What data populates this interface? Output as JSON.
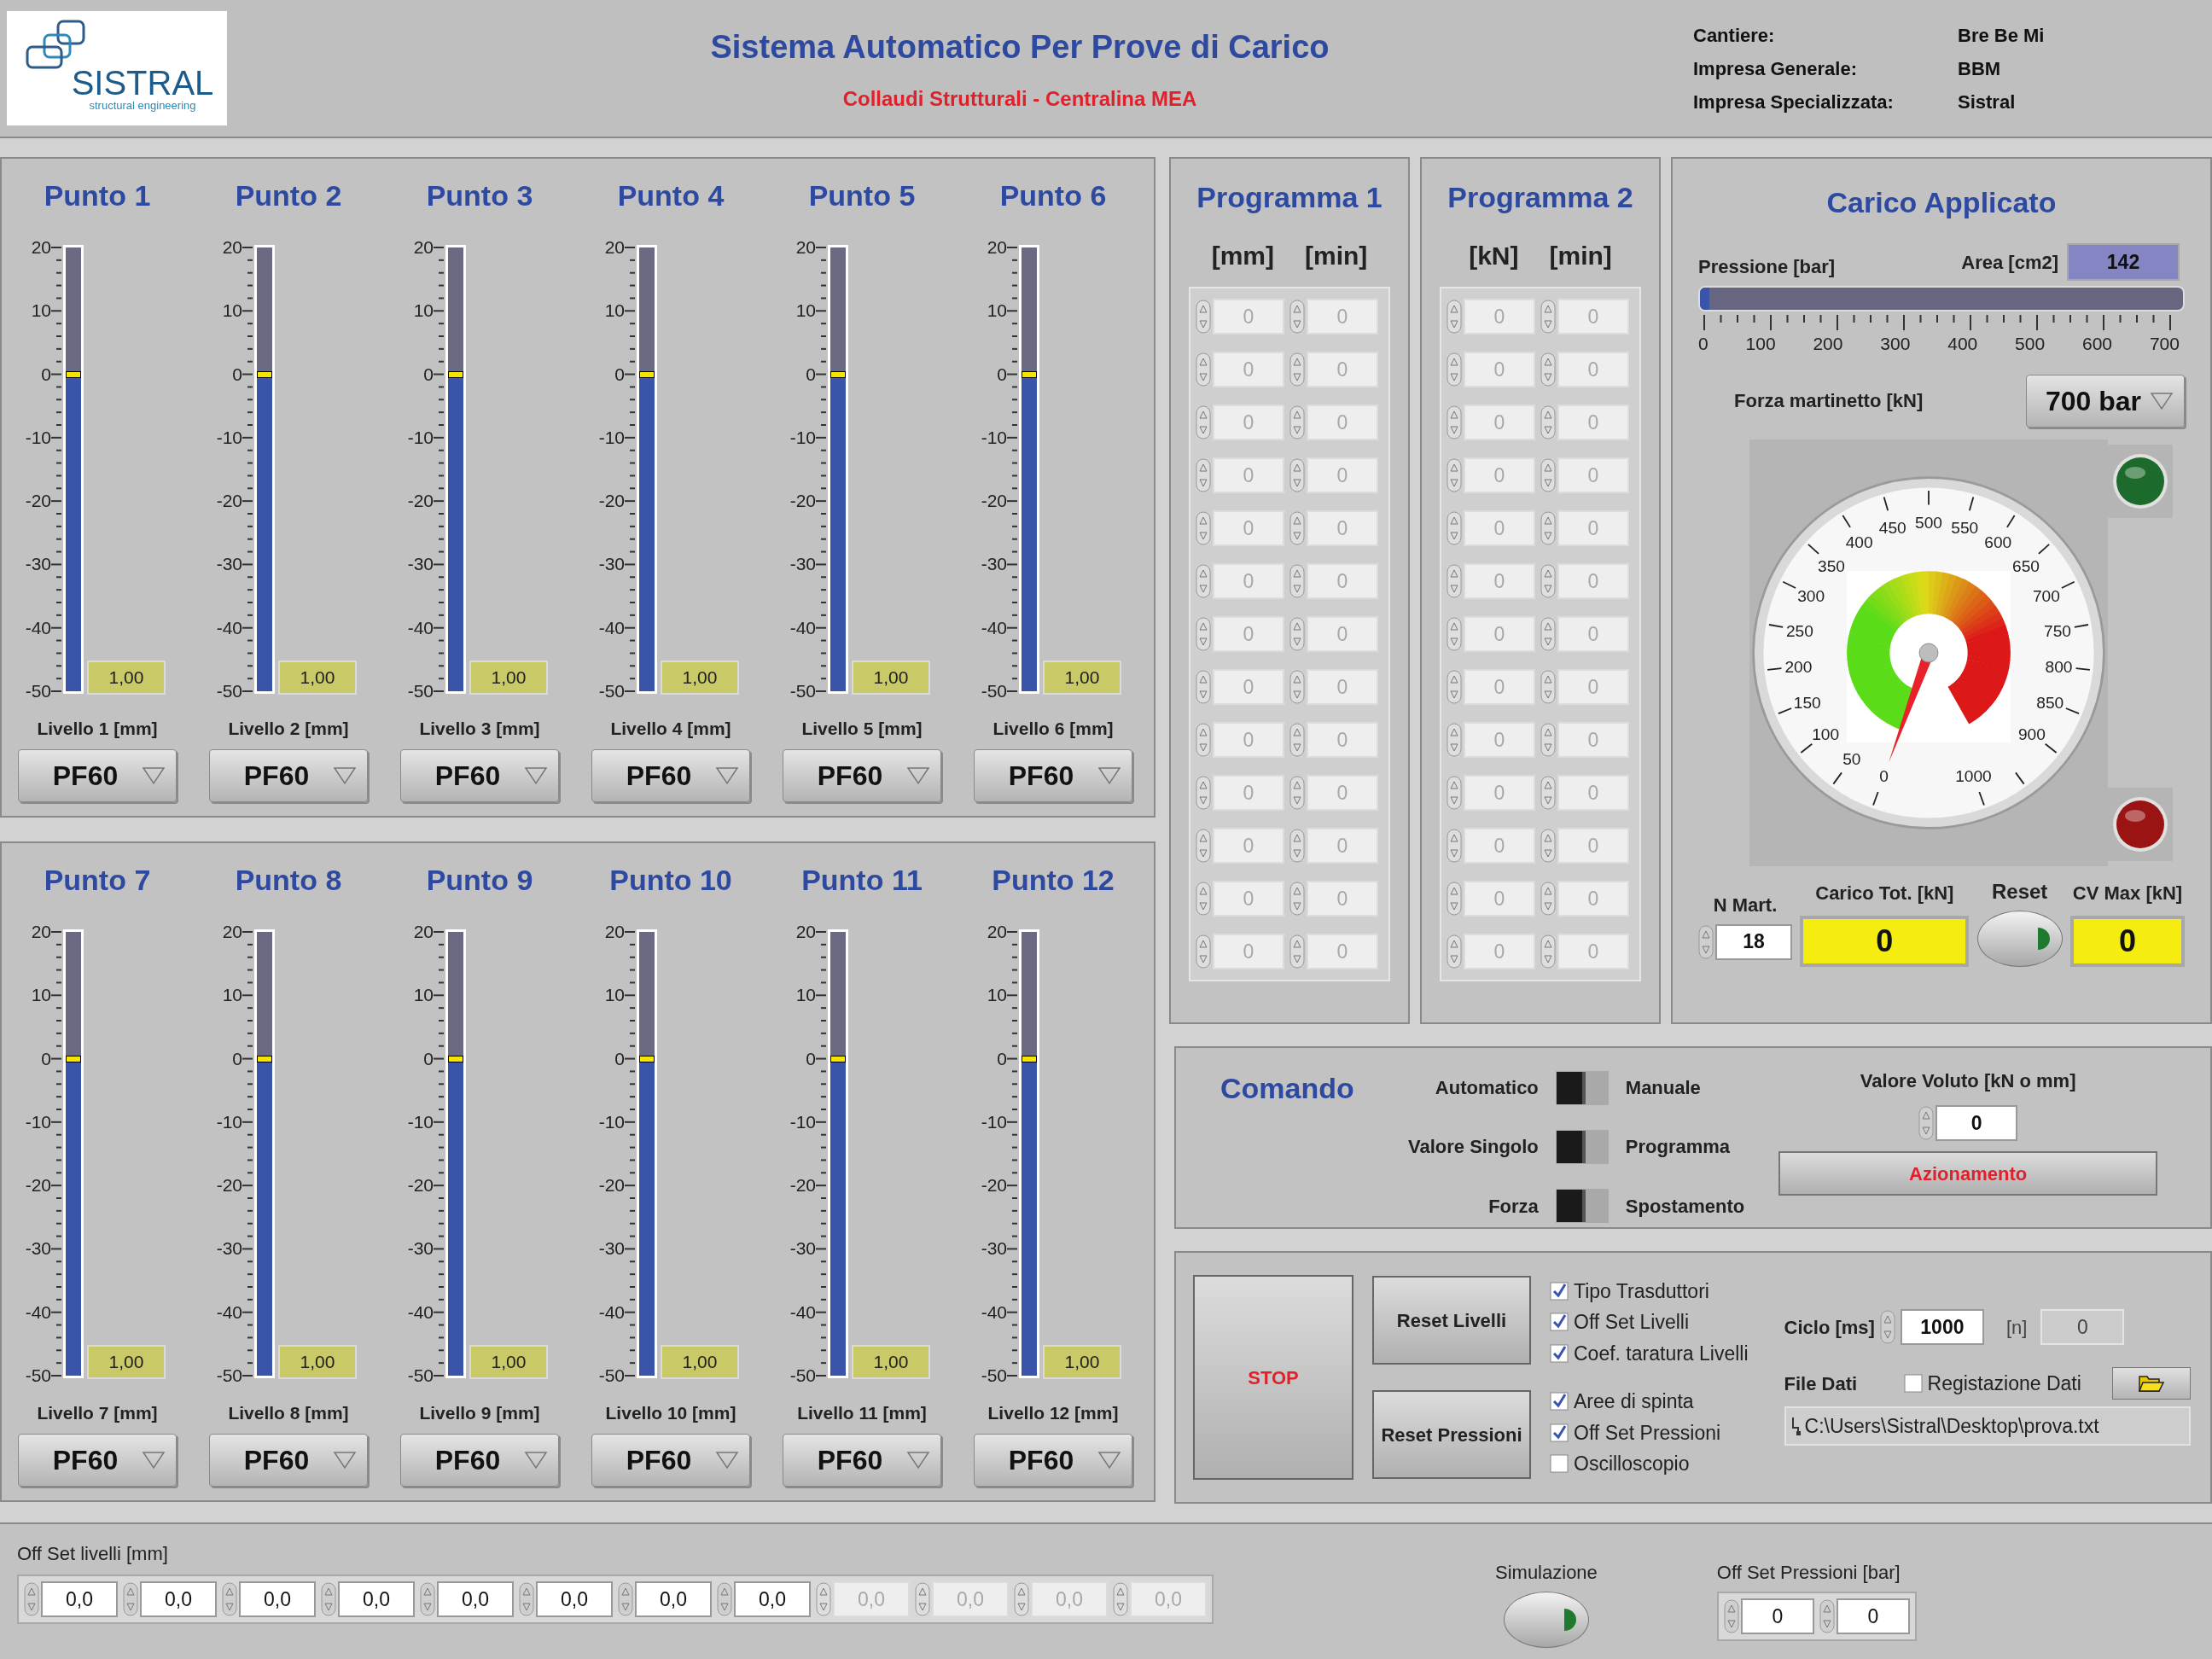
{
  "header": {
    "logo_text": "SISTRAL",
    "logo_tagline": "structural engineering",
    "title": "Sistema Automatico Per Prove di Carico",
    "subtitle": "Collaudi Strutturali - Centralina MEA",
    "info": [
      {
        "label": "Cantiere:",
        "value": "Bre Be Mi"
      },
      {
        "label": "Impresa Generale:",
        "value": "BBM"
      },
      {
        "label": "Impresa Specializzata:",
        "value": "Sistral"
      }
    ]
  },
  "tank_groups": [
    {
      "points": [
        {
          "title": "Punto 1",
          "scale": [
            "20",
            "10",
            "0",
            "-10",
            "-20",
            "-30",
            "-40",
            "-50"
          ],
          "level": 0.714,
          "reading": "1,00",
          "caption": "Livello 1 [mm]",
          "dropdown": "PF60"
        },
        {
          "title": "Punto 2",
          "scale": [
            "20",
            "10",
            "0",
            "-10",
            "-20",
            "-30",
            "-40",
            "-50"
          ],
          "level": 0.714,
          "reading": "1,00",
          "caption": "Livello 2 [mm]",
          "dropdown": "PF60"
        },
        {
          "title": "Punto 3",
          "scale": [
            "20",
            "10",
            "0",
            "-10",
            "-20",
            "-30",
            "-40",
            "-50"
          ],
          "level": 0.714,
          "reading": "1,00",
          "caption": "Livello 3 [mm]",
          "dropdown": "PF60"
        },
        {
          "title": "Punto 4",
          "scale": [
            "20",
            "10",
            "0",
            "-10",
            "-20",
            "-30",
            "-40",
            "-50"
          ],
          "level": 0.714,
          "reading": "1,00",
          "caption": "Livello 4 [mm]",
          "dropdown": "PF60"
        },
        {
          "title": "Punto 5",
          "scale": [
            "20",
            "10",
            "0",
            "-10",
            "-20",
            "-30",
            "-40",
            "-50"
          ],
          "level": 0.714,
          "reading": "1,00",
          "caption": "Livello 5 [mm]",
          "dropdown": "PF60"
        },
        {
          "title": "Punto 6",
          "scale": [
            "20",
            "10",
            "0",
            "-10",
            "-20",
            "-30",
            "-40",
            "-50"
          ],
          "level": 0.714,
          "reading": "1,00",
          "caption": "Livello 6 [mm]",
          "dropdown": "PF60"
        }
      ]
    },
    {
      "points": [
        {
          "title": "Punto 7",
          "scale": [
            "20",
            "10",
            "0",
            "-10",
            "-20",
            "-30",
            "-40",
            "-50"
          ],
          "level": 0.714,
          "reading": "1,00",
          "caption": "Livello 7 [mm]",
          "dropdown": "PF60"
        },
        {
          "title": "Punto 8",
          "scale": [
            "20",
            "10",
            "0",
            "-10",
            "-20",
            "-30",
            "-40",
            "-50"
          ],
          "level": 0.714,
          "reading": "1,00",
          "caption": "Livello 8 [mm]",
          "dropdown": "PF60"
        },
        {
          "title": "Punto 9",
          "scale": [
            "20",
            "10",
            "0",
            "-10",
            "-20",
            "-30",
            "-40",
            "-50"
          ],
          "level": 0.714,
          "reading": "1,00",
          "caption": "Livello 9 [mm]",
          "dropdown": "PF60"
        },
        {
          "title": "Punto 10",
          "scale": [
            "20",
            "10",
            "0",
            "-10",
            "-20",
            "-30",
            "-40",
            "-50"
          ],
          "level": 0.714,
          "reading": "1,00",
          "caption": "Livello 10 [mm]",
          "dropdown": "PF60"
        },
        {
          "title": "Punto 11",
          "scale": [
            "20",
            "10",
            "0",
            "-10",
            "-20",
            "-30",
            "-40",
            "-50"
          ],
          "level": 0.714,
          "reading": "1,00",
          "caption": "Livello 11 [mm]",
          "dropdown": "PF60"
        },
        {
          "title": "Punto 12",
          "scale": [
            "20",
            "10",
            "0",
            "-10",
            "-20",
            "-30",
            "-40",
            "-50"
          ],
          "level": 0.714,
          "reading": "1,00",
          "caption": "Livello 12 [mm]",
          "dropdown": "PF60"
        }
      ]
    }
  ],
  "programs": [
    {
      "title": "Programma 1",
      "columns": [
        "[mm]",
        "[min]"
      ],
      "disabled": true,
      "rows": [
        [
          "0",
          "0"
        ],
        [
          "0",
          "0"
        ],
        [
          "0",
          "0"
        ],
        [
          "0",
          "0"
        ],
        [
          "0",
          "0"
        ],
        [
          "0",
          "0"
        ],
        [
          "0",
          "0"
        ],
        [
          "0",
          "0"
        ],
        [
          "0",
          "0"
        ],
        [
          "0",
          "0"
        ],
        [
          "0",
          "0"
        ],
        [
          "0",
          "0"
        ],
        [
          "0",
          "0"
        ]
      ]
    },
    {
      "title": "Programma 2",
      "columns": [
        "[kN]",
        "[min]"
      ],
      "disabled": true,
      "rows": [
        [
          "0",
          "0"
        ],
        [
          "0",
          "0"
        ],
        [
          "0",
          "0"
        ],
        [
          "0",
          "0"
        ],
        [
          "0",
          "0"
        ],
        [
          "0",
          "0"
        ],
        [
          "0",
          "0"
        ],
        [
          "0",
          "0"
        ],
        [
          "0",
          "0"
        ],
        [
          "0",
          "0"
        ],
        [
          "0",
          "0"
        ],
        [
          "0",
          "0"
        ],
        [
          "0",
          "0"
        ]
      ]
    }
  ],
  "carico": {
    "title": "Carico Applicato",
    "pressure": {
      "label": "Pressione [bar]",
      "level": 0.02,
      "ticks": [
        "0",
        "100",
        "200",
        "300",
        "400",
        "500",
        "600",
        "700"
      ]
    },
    "area": {
      "label": "Area [cm2]",
      "value": "142"
    },
    "force": {
      "label": "Forza martinetto [kN]",
      "dropdown": "700 bar"
    },
    "dial": {
      "labels": [
        "0",
        "50",
        "100",
        "150",
        "200",
        "250",
        "300",
        "350",
        "400",
        "450",
        "500",
        "550",
        "600",
        "650",
        "700",
        "750",
        "800",
        "850",
        "900",
        "1000"
      ]
    },
    "leds": [
      {
        "color": "#1d6b2c",
        "on": true
      },
      {
        "color": "#9a1414",
        "on": true
      }
    ],
    "n_mart": {
      "label": "N Mart.",
      "value": "18"
    },
    "carico_tot": {
      "label": "Carico Tot. [kN]",
      "value": "0"
    },
    "reset": {
      "label": "Reset",
      "on": true
    },
    "cv_max": {
      "label": "CV Max [kN]",
      "value": "0"
    }
  },
  "comando": {
    "title": "Comando",
    "switches": [
      {
        "left": "Automatico",
        "right": "Manuale",
        "on": false
      },
      {
        "left": "Valore Singolo",
        "right": "Programma",
        "on": false
      },
      {
        "left": "Forza",
        "right": "Spostamento",
        "on": false
      }
    ],
    "target": {
      "label": "Valore Voluto [kN o mm]",
      "value": "0"
    },
    "action": "Azionamento"
  },
  "controls": {
    "stop": "STOP",
    "buttons": [
      "Reset Livelli",
      "Reset Pressioni"
    ],
    "check_groups": [
      [
        {
          "label": "Tipo Trasduttori",
          "checked": true
        },
        {
          "label": "Off Set Livelli",
          "checked": true
        },
        {
          "label": "Coef. taratura Livelli",
          "checked": true
        }
      ],
      [
        {
          "label": "Aree di spinta",
          "checked": true
        },
        {
          "label": "Off Set Pressioni",
          "checked": true
        },
        {
          "label": "Oscilloscopio",
          "checked": false
        }
      ]
    ],
    "cycle": {
      "label": "Ciclo [ms]",
      "value": "1000"
    },
    "count": {
      "label": "[n]",
      "value": "0"
    },
    "file": {
      "label": "File Dati",
      "record": {
        "label": "Registazione Dati",
        "checked": false
      },
      "path": "C:\\Users\\Sistral\\Desktop\\prova.txt"
    }
  },
  "footer": {
    "offset_levels": {
      "label": "Off Set livelli [mm]",
      "fields": [
        {
          "value": "0,0",
          "disabled": false
        },
        {
          "value": "0,0",
          "disabled": false
        },
        {
          "value": "0,0",
          "disabled": false
        },
        {
          "value": "0,0",
          "disabled": false
        },
        {
          "value": "0,0",
          "disabled": false
        },
        {
          "value": "0,0",
          "disabled": false
        },
        {
          "value": "0,0",
          "disabled": false
        },
        {
          "value": "0,0",
          "disabled": false
        },
        {
          "value": "0,0",
          "disabled": true
        },
        {
          "value": "0,0",
          "disabled": true
        },
        {
          "value": "0,0",
          "disabled": true
        },
        {
          "value": "0,0",
          "disabled": true
        }
      ]
    },
    "simulation": {
      "label": "Simulazione",
      "on": true
    },
    "offset_pressures": {
      "label": "Off Set Pressioni [bar]",
      "fields": [
        {
          "value": "0",
          "disabled": false
        },
        {
          "value": "0",
          "disabled": false
        }
      ]
    }
  }
}
